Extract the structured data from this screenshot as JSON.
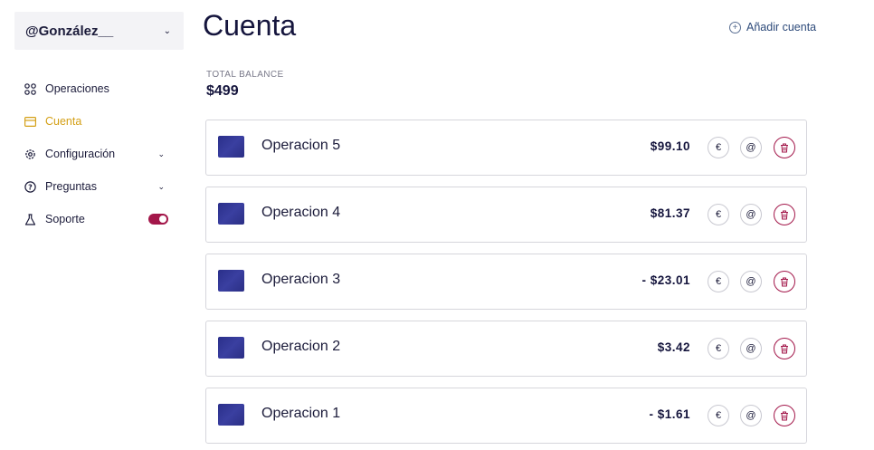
{
  "sidebar": {
    "user": "@González__",
    "items": [
      {
        "label": "Operaciones",
        "icon": "grid-icon"
      },
      {
        "label": "Cuenta",
        "icon": "card-icon",
        "active": true
      },
      {
        "label": "Configuración",
        "icon": "gear-icon",
        "expandable": true
      },
      {
        "label": "Preguntas",
        "icon": "question-icon",
        "expandable": true
      },
      {
        "label": "Soporte",
        "icon": "flask-icon",
        "toggle": true
      }
    ]
  },
  "header": {
    "title": "Cuenta",
    "add_account": "Añadir cuenta"
  },
  "balance": {
    "label": "TOTAL BALANCE",
    "value": "$499"
  },
  "operations": [
    {
      "name": "Operacion 5",
      "amount": "$99.10"
    },
    {
      "name": "Operacion 4",
      "amount": "$81.37"
    },
    {
      "name": "Operacion 3",
      "amount": "- $23.01"
    },
    {
      "name": "Operacion 2",
      "amount": "$3.42"
    },
    {
      "name": "Operacion 1",
      "amount": "- $1.61"
    }
  ],
  "colors": {
    "active": "#d4a017",
    "accent": "#a3174a",
    "primary_text": "#15153d"
  }
}
